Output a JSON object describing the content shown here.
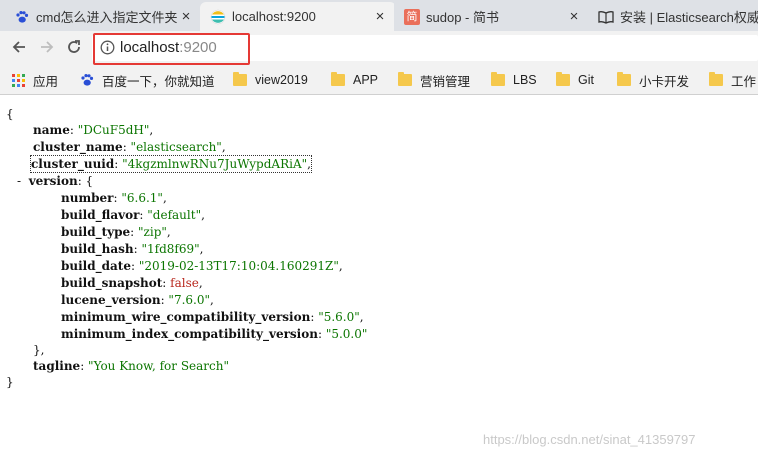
{
  "tabs": [
    {
      "title": "cmd怎么进入指定文件夹",
      "close": "×"
    },
    {
      "title": "localhost:9200",
      "close": "×"
    },
    {
      "title": "sudop - 简书",
      "close": "×",
      "favicon_text": "简"
    },
    {
      "title": "安装 | Elasticsearch权威",
      "close": "×"
    }
  ],
  "address": {
    "host": "localhost",
    "port": ":9200"
  },
  "bookmarks": [
    {
      "label": "应用",
      "icon": "apps-grid-icon"
    },
    {
      "label": "百度一下，你就知道",
      "icon": "baidu-paw-icon"
    },
    {
      "label": "view2019",
      "icon": "folder-icon"
    },
    {
      "label": "APP",
      "icon": "folder-icon"
    },
    {
      "label": "营销管理",
      "icon": "folder-icon"
    },
    {
      "label": "LBS",
      "icon": "folder-icon"
    },
    {
      "label": "Git",
      "icon": "folder-icon"
    },
    {
      "label": "小卡开发",
      "icon": "folder-icon"
    },
    {
      "label": "工作",
      "icon": "folder-icon"
    }
  ],
  "json": {
    "open_brace": "{",
    "close_brace": "}",
    "name": {
      "key": "name",
      "value": "\"DCuF5dH\""
    },
    "cluster_name": {
      "key": "cluster_name",
      "value": "\"elasticsearch\""
    },
    "cluster_uuid": {
      "key": "cluster_uuid",
      "value": "\"4kgzmlnwRNu7JuWypdARiA\""
    },
    "version": {
      "toggle": "-",
      "key": "version",
      "open": "{",
      "close": "},",
      "number": {
        "key": "number",
        "value": "\"6.6.1\""
      },
      "build_flavor": {
        "key": "build_flavor",
        "value": "\"default\""
      },
      "build_type": {
        "key": "build_type",
        "value": "\"zip\""
      },
      "build_hash": {
        "key": "build_hash",
        "value": "\"1fd8f69\""
      },
      "build_date": {
        "key": "build_date",
        "value": "\"2019-02-13T17:10:04.160291Z\""
      },
      "build_snapshot": {
        "key": "build_snapshot",
        "value": "false"
      },
      "lucene_version": {
        "key": "lucene_version",
        "value": "\"7.6.0\""
      },
      "minimum_wire_compatibility_version": {
        "key": "minimum_wire_compatibility_version",
        "value": "\"5.6.0\""
      },
      "minimum_index_compatibility_version": {
        "key": "minimum_index_compatibility_version",
        "value": "\"5.0.0\""
      }
    },
    "tagline": {
      "key": "tagline",
      "value": "\"You Know, for Search\""
    }
  },
  "watermark": "https://blog.csdn.net/sinat_41359797",
  "colors": {
    "string": "#0b7500",
    "boolean": "#b8271d",
    "highlight": "#e53935"
  }
}
